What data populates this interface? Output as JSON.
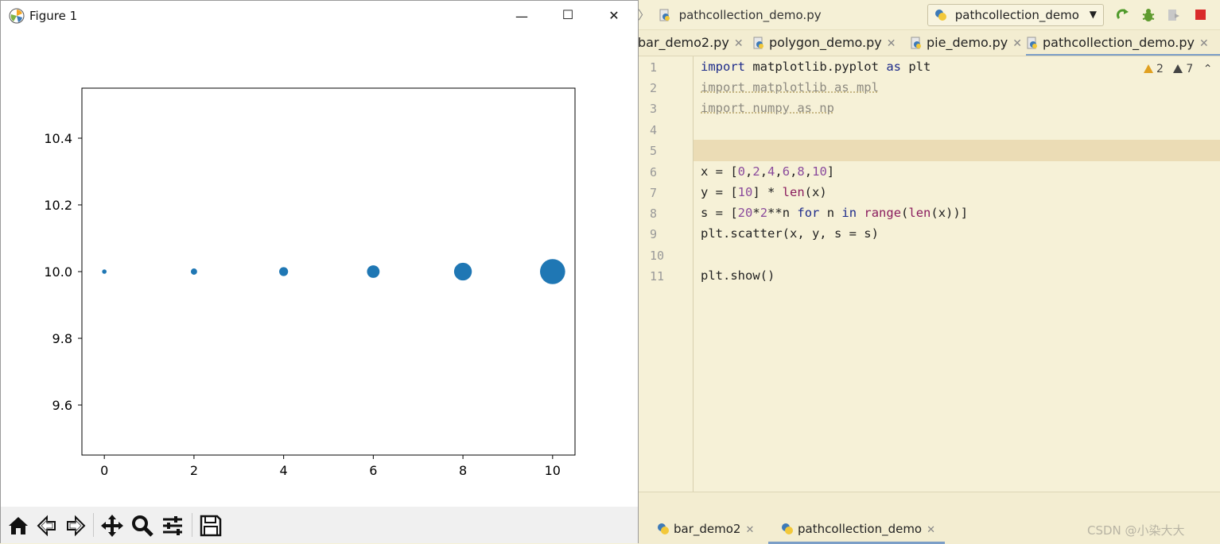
{
  "figure_window": {
    "title": "Figure 1",
    "controls": {
      "minimize": "—",
      "maximize": "☐",
      "close": "✕"
    },
    "toolbar_icons": [
      "home-icon",
      "back-icon",
      "forward-icon",
      "pan-icon",
      "zoom-icon",
      "configure-subplots-icon",
      "save-icon"
    ]
  },
  "chart_data": {
    "type": "scatter",
    "x": [
      0,
      2,
      4,
      6,
      8,
      10
    ],
    "y": [
      10,
      10,
      10,
      10,
      10,
      10
    ],
    "sizes": [
      20,
      40,
      80,
      160,
      320,
      640
    ],
    "color": "#1f77b4",
    "xlim": [
      -0.5,
      10.5
    ],
    "ylim": [
      9.45,
      10.55
    ],
    "xticks": [
      0,
      2,
      4,
      6,
      8,
      10
    ],
    "yticks": [
      9.6,
      9.8,
      10.0,
      10.2,
      10.4
    ],
    "xtick_labels": [
      "0",
      "2",
      "4",
      "6",
      "8",
      "10"
    ],
    "ytick_labels": [
      "9.6",
      "9.8",
      "10.0",
      "10.2",
      "10.4"
    ],
    "title": "",
    "xlabel": "",
    "ylabel": "",
    "grid": false
  },
  "ide": {
    "breadcrumb_file": "pathcollection_demo.py",
    "run_config": "pathcollection_demo",
    "toolbar_icons": [
      "rerun-icon",
      "debug-icon",
      "coverage-icon",
      "stop-icon"
    ],
    "tabs": [
      {
        "label": "bar_demo2.py",
        "active": false
      },
      {
        "label": "polygon_demo.py",
        "active": false
      },
      {
        "label": "pie_demo.py",
        "active": false
      },
      {
        "label": "pathcollection_demo.py",
        "active": true
      }
    ],
    "warnings": {
      "weak_count": "2",
      "warning_count": "7"
    },
    "line_numbers": [
      "1",
      "2",
      "3",
      "4",
      "5",
      "6",
      "7",
      "8",
      "9",
      "10",
      "11"
    ],
    "code_lines": [
      "import matplotlib.pyplot as plt",
      "import matplotlib as mpl",
      "import numpy as np",
      "",
      "",
      "x = [0,2,4,6,8,10]",
      "y = [10] * len(x)",
      "s = [20*2**n for n in range(len(x))]",
      "plt.scatter(x, y, s = s)",
      "",
      "plt.show()"
    ],
    "bottom_tabs": [
      {
        "label": "bar_demo2",
        "active": false
      },
      {
        "label": "pathcollection_demo",
        "active": true
      }
    ],
    "watermark": "CSDN @小染大大",
    "colors": {
      "background": "#f6f1d7",
      "current_line": "#ebdcb5",
      "keyword": "#1c2a8a",
      "number": "#8a4a9c"
    }
  }
}
